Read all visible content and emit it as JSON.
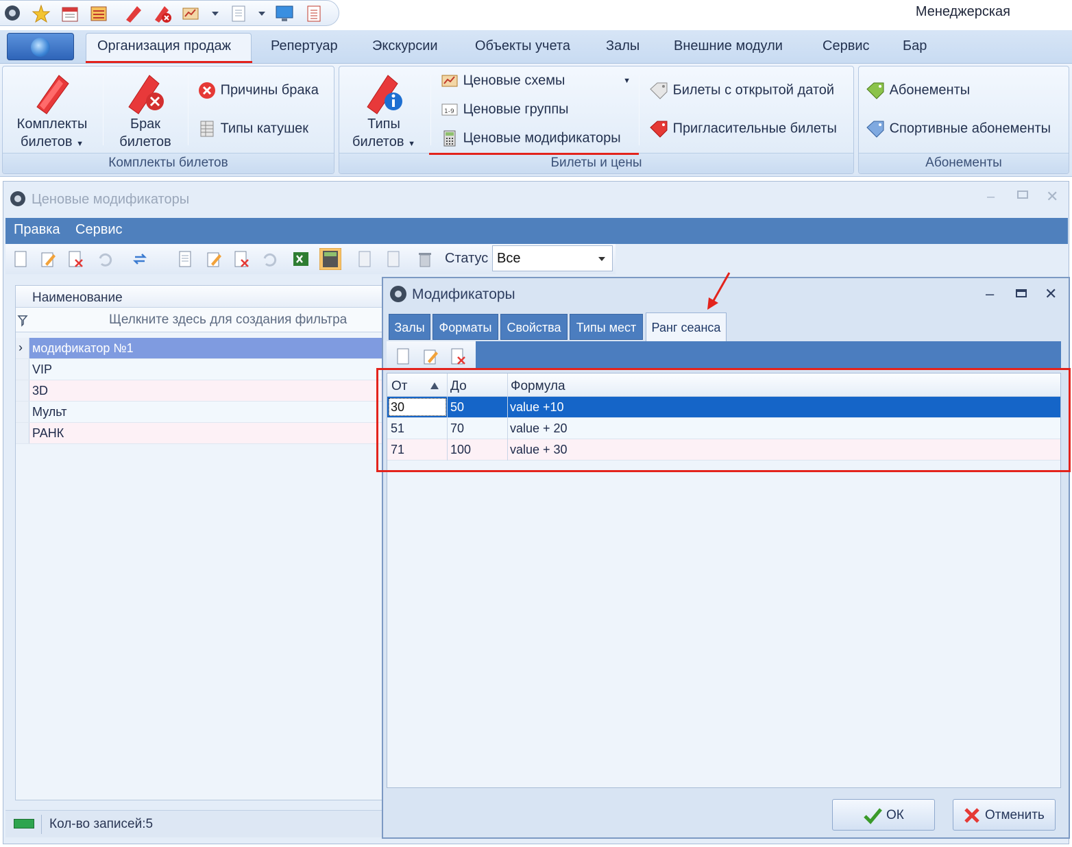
{
  "app_title": "Менеджерская",
  "ribbon": {
    "tabs": [
      "Организация продаж",
      "Репертуар",
      "Экскурсии",
      "Объекты учета",
      "Залы",
      "Внешние модули",
      "Сервис",
      "Бар"
    ],
    "groups": {
      "sets": {
        "label": "Комплекты билетов",
        "btn_sets_l1": "Комплекты",
        "btn_sets_l2": "билетов",
        "btn_defect_l1": "Брак",
        "btn_defect_l2": "билетов",
        "defect_reasons": "Причины брака",
        "reel_types": "Типы катушек"
      },
      "tickets": {
        "label": "Билеты и цены",
        "btn_types_l1": "Типы",
        "btn_types_l2": "билетов",
        "price_schemes": "Ценовые схемы",
        "price_groups": "Ценовые группы",
        "price_modifiers": "Ценовые модификаторы",
        "open_date": "Билеты с открытой датой",
        "invitations": "Пригласительные билеты"
      },
      "subs": {
        "label": "Абонементы",
        "subscriptions": "Абонементы",
        "sport_subs": "Спортивные абонементы"
      }
    }
  },
  "main_window": {
    "title": "Ценовые модификаторы",
    "menu": [
      "Правка",
      "Сервис"
    ],
    "status_label": "Статус",
    "status_value": "Все",
    "grid": {
      "column": "Наименование",
      "filter_hint": "Щелкните здесь для создания фильтра",
      "rows": [
        "модификатор №1",
        "VIP",
        "3D",
        "Мульт",
        "РАНК"
      ]
    },
    "record_count": "Кол-во записей:5"
  },
  "dialog": {
    "title": "Модификаторы",
    "tabs": [
      "Залы",
      "Форматы",
      "Свойства",
      "Типы мест",
      "Ранг сеанса"
    ],
    "columns": [
      "От",
      "До",
      "Формула"
    ],
    "rows": [
      {
        "from": "30",
        "to": "50",
        "formula": "value +10"
      },
      {
        "from": "51",
        "to": "70",
        "formula": "value + 20"
      },
      {
        "from": "71",
        "to": "100",
        "formula": "value + 30"
      }
    ],
    "ok": "ОК",
    "cancel": "Отменить"
  },
  "colors": {
    "accent_blue": "#4f80bd",
    "selection": "#1565c8",
    "annotation_red": "#e3231c"
  }
}
